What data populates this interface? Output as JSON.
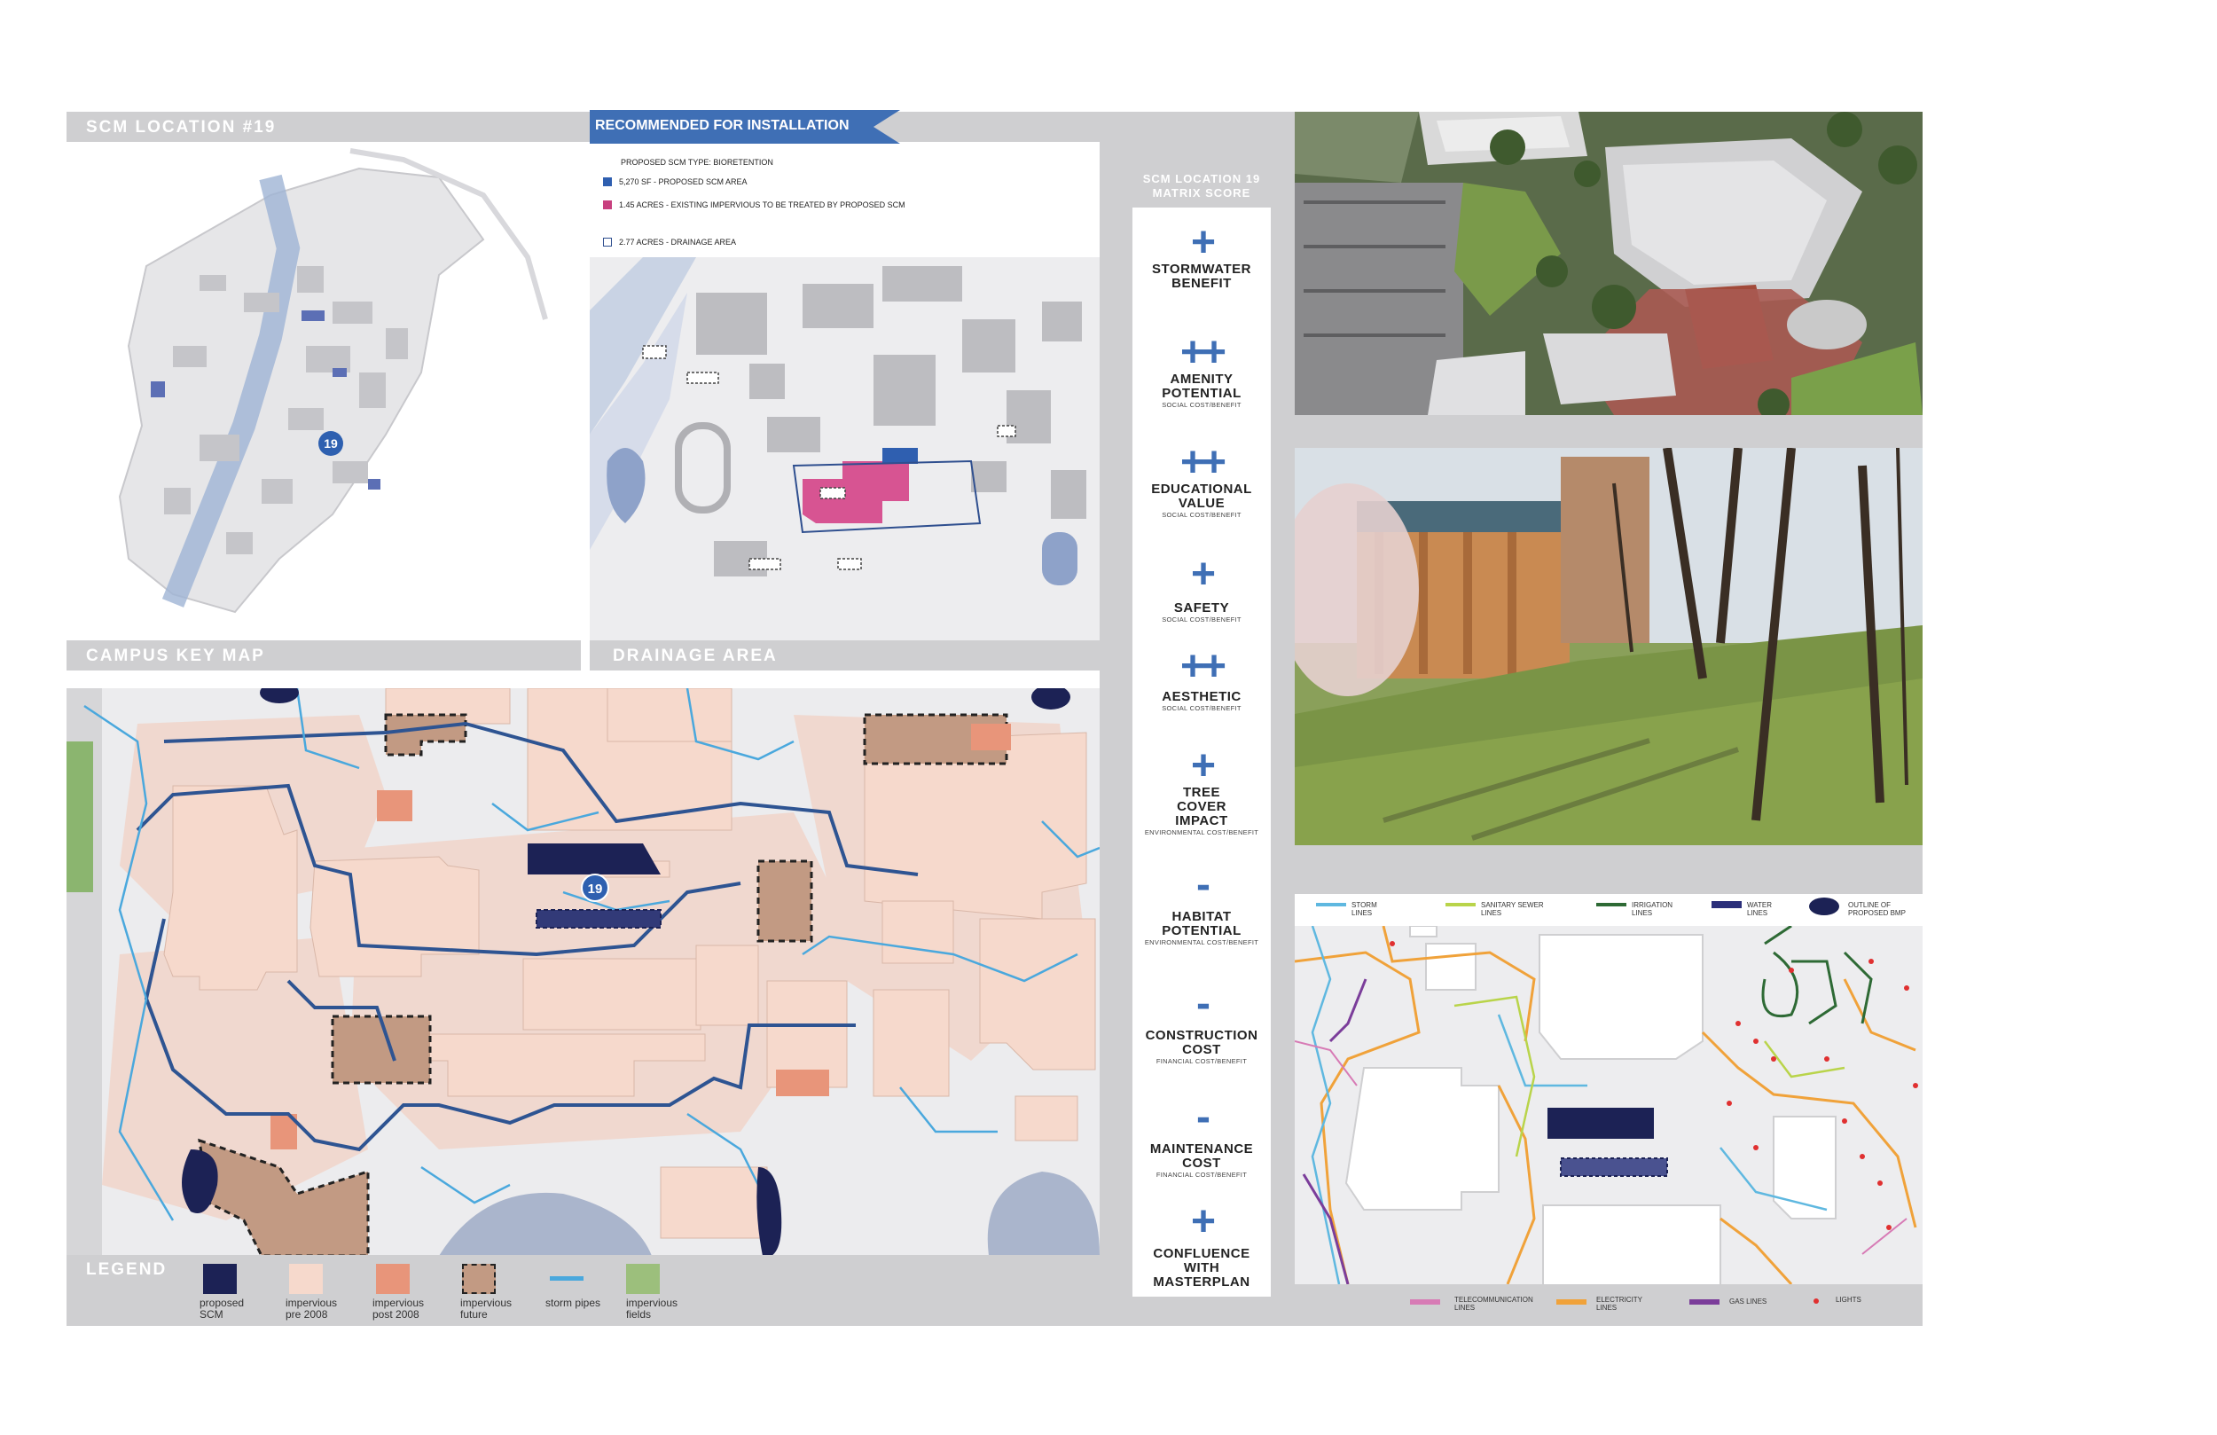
{
  "headers": {
    "location": "SCM LOCATION #19",
    "recommended": "RECOMMENDED FOR INSTALLATION",
    "campus_key_map": "CAMPUS KEY MAP",
    "drainage_area": "DRAINAGE AREA",
    "legend": "LEGEND"
  },
  "drainage_notes": {
    "type": "PROPOSED SCM TYPE: BIORETENTION",
    "items": [
      {
        "text": "5,270 SF - PROPOSED SCM AREA",
        "color": "#2f5fb0"
      },
      {
        "text": "1.45 ACRES - EXISTING IMPERVIOUS TO BE TREATED BY PROPOSED SCM",
        "color": "#c8407f"
      },
      {
        "text": "2.77 ACRES - DRAINAGE AREA",
        "color": "#2f4f8f"
      }
    ]
  },
  "map_marker": "19",
  "matrix": {
    "title_line1": "SCM LOCATION 19",
    "title_line2": "MATRIX SCORE",
    "items": [
      {
        "symbol": "+",
        "label": "STORMWATER BENEFIT",
        "sub": ""
      },
      {
        "symbol": "++",
        "label": "AMENITY POTENTIAL",
        "sub": "SOCIAL COST/BENEFIT"
      },
      {
        "symbol": "++",
        "label": "EDUCATIONAL VALUE",
        "sub": "SOCIAL COST/BENEFIT"
      },
      {
        "symbol": "+",
        "label": "SAFETY",
        "sub": "SOCIAL COST/BENEFIT"
      },
      {
        "symbol": "++",
        "label": "AESTHETIC",
        "sub": "SOCIAL COST/BENEFIT"
      },
      {
        "symbol": "+",
        "label": "TREE COVER IMPACT",
        "sub": "ENVIRONMENTAL COST/BENEFIT"
      },
      {
        "symbol": "-",
        "label": "HABITAT POTENTIAL",
        "sub": "ENVIRONMENTAL COST/BENEFIT"
      },
      {
        "symbol": "-",
        "label": "CONSTRUCTION COST",
        "sub": "FINANCIAL COST/BENEFIT"
      },
      {
        "symbol": "-",
        "label": "MAINTENANCE COST",
        "sub": "FINANCIAL COST/BENEFIT"
      },
      {
        "symbol": "+",
        "label": "CONFLUENCE WITH MASTERPLAN",
        "sub": ""
      }
    ]
  },
  "legend": [
    {
      "label": "proposed SCM",
      "color": "#1c2255"
    },
    {
      "label": "impervious pre 2008",
      "color": "#f6d9cc"
    },
    {
      "label": "impervious post 2008",
      "color": "#e8957a"
    },
    {
      "label": "impervious future",
      "color": "#c29a83"
    },
    {
      "label": "storm pipes",
      "color": "#4aa8dd"
    },
    {
      "label": "impervious fields",
      "color": "#9cbf7c"
    }
  ],
  "utility_legend_top": [
    {
      "label": "STORM LINES",
      "color": "#5fb8e0"
    },
    {
      "label": "SANITARY SEWER LINES",
      "color": "#b9d44a"
    },
    {
      "label": "IRRIGATION LINES",
      "color": "#2e6a35"
    },
    {
      "label": "WATER LINES",
      "color": "#2b2f7a"
    },
    {
      "label": "OUTLINE OF PROPOSED BMP",
      "color": "#1c2255"
    }
  ],
  "utility_legend_bottom": [
    {
      "label": "TELECOMMUNICATION LINES",
      "color": "#d77bb5"
    },
    {
      "label": "ELECTRICITY LINES",
      "color": "#f0a23a"
    },
    {
      "label": "GAS LINES",
      "color": "#7b3d9a"
    },
    {
      "label": "LIGHTS",
      "color": "#e03030"
    }
  ]
}
